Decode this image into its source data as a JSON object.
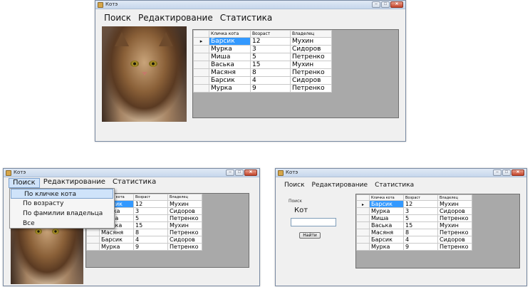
{
  "window": {
    "title": "Котэ",
    "min_label": "–",
    "max_label": "□",
    "close_label": "✕"
  },
  "menu": {
    "search": "Поиск",
    "edit": "Редактирование",
    "stats": "Статистика"
  },
  "grid": {
    "columns": [
      "Кличка кота",
      "Возраст",
      "Владелец"
    ],
    "current_row_marker": "▸",
    "rows": [
      [
        "Барсик",
        "12",
        "Мухин"
      ],
      [
        "Мурка",
        "3",
        "Сидоров"
      ],
      [
        "Миша",
        "5",
        "Петренко"
      ],
      [
        "Васька",
        "15",
        "Мухин"
      ],
      [
        "Масяня",
        "8",
        "Петренко"
      ],
      [
        "Барсик",
        "4",
        "Сидоров"
      ],
      [
        "Мурка",
        "9",
        "Петренко"
      ]
    ]
  },
  "search_menu": {
    "items": [
      "По кличке кота",
      "По возрасту",
      "По фамилии владельца",
      "Все"
    ]
  },
  "search_panel": {
    "group_label": "Поиск",
    "field_label": "Кот",
    "input_value": "",
    "button_label": "Найти"
  },
  "icons": {
    "app": "cat-app-icon",
    "row_marker": "current-row-arrow-icon"
  },
  "colors": {
    "selection": "#3399ff",
    "menu_highlight": "#cfe3fa",
    "grid_background": "#a9a9a9"
  }
}
